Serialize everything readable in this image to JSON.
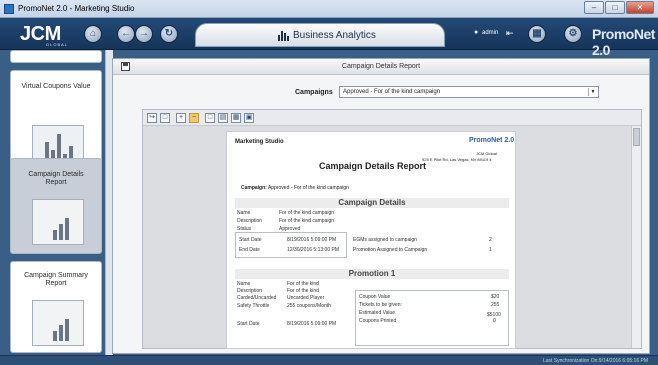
{
  "window": {
    "title": "PromoNet 2.0 - Marketing Studio"
  },
  "appbar": {
    "logo": "JCM",
    "logo_sub": "GLOBAL",
    "tab_title": "Business Analytics",
    "user": "admin",
    "brand": "PromoNet 2.0"
  },
  "sidebar": {
    "items": [
      {
        "label": "Virtual Coupons Value"
      },
      {
        "label": "Campaign Details Report"
      },
      {
        "label": "Campaign Summary Report"
      }
    ]
  },
  "main": {
    "header_title": "Campaign Details Report",
    "campaigns_label": "Campaigns",
    "campaign_selected": "Approved - For of the kind campaign"
  },
  "report": {
    "studio_label": "Marketing Studio",
    "brand": "PromoNet 2.0",
    "company": "JCM Global",
    "address": "925 E Pilot Rd, Las Vegas, NV 89119 4",
    "title": "Campaign Details Report",
    "campaign_label": "Campaign:",
    "campaign_value": "Approved - For of the kind campaign",
    "section_details": "Campaign Details",
    "details": [
      {
        "k": "Name",
        "v": "For of the kind campaign"
      },
      {
        "k": "Description",
        "v": "For of the kind campaign"
      },
      {
        "k": "Status",
        "v": "Approved"
      }
    ],
    "start_date_label": "Start Date",
    "start_date": "8/19/2016 5:09:00 PM",
    "end_date_label": "End Date",
    "end_date": "12/30/2016 5:13:00 PM",
    "egms_label": "EGMs assigned to campaign",
    "egms_value": "2",
    "promo_assigned_label": "Promotion Assigned to Campaign",
    "promo_assigned_value": "1",
    "section_promo": "Promotion 1",
    "promo": [
      {
        "k": "Name",
        "v": "For of the kind"
      },
      {
        "k": "Description",
        "v": "For of the kind"
      },
      {
        "k": "Carded/Uncarded",
        "v": "Uncarded Player"
      },
      {
        "k": "Safety Throttle",
        "v": "255 coupons/Month"
      }
    ],
    "promo_start_label": "Start Date",
    "promo_start": "8/19/2016 5:09:00 PM",
    "coupons": [
      {
        "k": "Coupon Value",
        "v": "$20"
      },
      {
        "k": "Tickets to be given:",
        "v": "255"
      },
      {
        "k": "Estimated Value",
        "v": "$5100"
      },
      {
        "k": "Coupons Printed",
        "v": "0"
      }
    ]
  },
  "status": {
    "text": "Last Synchronization On:9/14/2016 6:05:16 PM"
  }
}
